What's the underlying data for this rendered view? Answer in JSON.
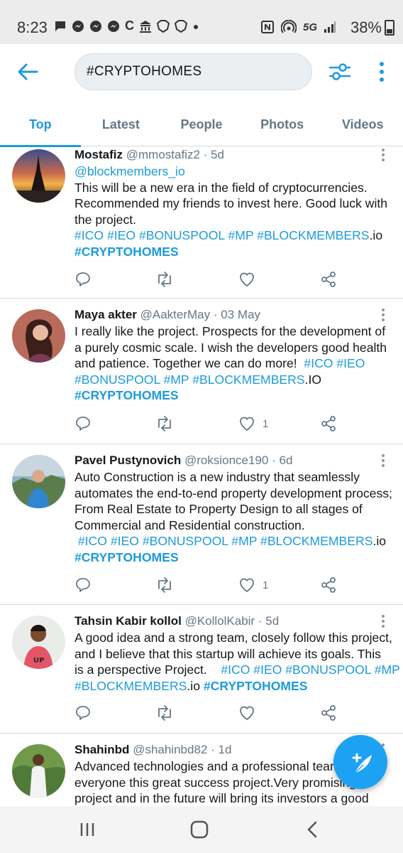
{
  "status_bar": {
    "time": "8:23",
    "network": "5G",
    "battery": "38%",
    "left_icons": [
      "chat-icon",
      "messenger-icon",
      "messenger-icon",
      "messenger-icon",
      "c-icon",
      "bank-icon",
      "brave-icon",
      "brave-icon",
      "dot-icon"
    ],
    "right_icons": [
      "nfc-icon",
      "hotspot-icon",
      "signal-icon",
      "battery-icon"
    ]
  },
  "search": {
    "query": "#CRYPTOHOMES"
  },
  "tabs": [
    {
      "label": "Top",
      "active": true
    },
    {
      "label": "Latest",
      "active": false
    },
    {
      "label": "People",
      "active": false
    },
    {
      "label": "Photos",
      "active": false
    },
    {
      "label": "Videos",
      "active": false
    }
  ],
  "colors": {
    "accent": "#1d9bd9",
    "fab": "#1da1f2",
    "secondary_text": "#657786"
  },
  "tweets": [
    {
      "name": "Mostafiz",
      "handle": "@mmostafiz2",
      "time": "5d",
      "lines": [
        [
          {
            "t": "@blockmembers_io",
            "s": "tag"
          }
        ],
        [
          {
            "t": "This will be a new era in the field of cryptocurrencies.",
            "s": ""
          }
        ],
        [
          {
            "t": "Recommended my friends to invest here. Good luck with",
            "s": ""
          }
        ],
        [
          {
            "t": "the project.",
            "s": ""
          }
        ],
        [
          {
            "t": "#ICO #IEO #BONUSPOOL #MP #BLOCKMEMBERS",
            "s": "tag"
          },
          {
            "t": ".io",
            "s": ""
          }
        ],
        [
          {
            "t": "#CRYPTOHOMES",
            "s": "tag-b"
          }
        ]
      ],
      "likes": ""
    },
    {
      "name": "Maya akter",
      "handle": "@AakterMay",
      "time": "03 May",
      "lines": [
        [
          {
            "t": "I really like the project. Prospects for the development of",
            "s": ""
          }
        ],
        [
          {
            "t": "a purely cosmic scale. I wish the developers good health",
            "s": ""
          }
        ],
        [
          {
            "t": "and patience. Together we can do more!  ",
            "s": ""
          },
          {
            "t": "#ICO #IEO",
            "s": "tag"
          }
        ],
        [
          {
            "t": "#BONUSPOOL #MP #BLOCKMEMBERS",
            "s": "tag"
          },
          {
            "t": ".IO",
            "s": ""
          }
        ],
        [
          {
            "t": "#CRYPTOHOMES",
            "s": "tag-b"
          }
        ]
      ],
      "likes": "1"
    },
    {
      "name": "Pavel Pustynovich",
      "handle": "@roksionce190",
      "time": "6d",
      "lines": [
        [
          {
            "t": "Auto Construction is a new industry that seamlessly",
            "s": ""
          }
        ],
        [
          {
            "t": "automates the end-to-end property development process;",
            "s": ""
          }
        ],
        [
          {
            "t": "From Real Estate to Property Design to all stages of",
            "s": ""
          }
        ],
        [
          {
            "t": "Commercial and Residential construction.",
            "s": ""
          }
        ],
        [
          {
            "t": " #ICO #IEO #BONUSPOOL #MP #BLOCKMEMBERS",
            "s": "tag"
          },
          {
            "t": ".io",
            "s": ""
          }
        ],
        [
          {
            "t": "#CRYPTOHOMES",
            "s": "tag-b"
          }
        ]
      ],
      "likes": "1"
    },
    {
      "name": "Tahsin Kabir kollol",
      "handle": "@KollolKabir",
      "time": "5d",
      "lines": [
        [
          {
            "t": "A good idea and a strong team, closely follow this project,",
            "s": ""
          }
        ],
        [
          {
            "t": "and I believe that this startup will achieve its goals. This",
            "s": ""
          }
        ],
        [
          {
            "t": "is a perspective Project.    ",
            "s": ""
          },
          {
            "t": "#ICO #IEO #BONUSPOOL #MP",
            "s": "tag"
          }
        ],
        [
          {
            "t": "#BLOCKMEMBERS",
            "s": "tag"
          },
          {
            "t": ".io ",
            "s": ""
          },
          {
            "t": "#CRYPTOHOMES",
            "s": "tag-b"
          }
        ]
      ],
      "likes": ""
    },
    {
      "name": "Shahinbd",
      "handle": "@shahinbd82",
      "time": "1d",
      "lines": [
        [
          {
            "t": "Advanced technologies and a professional team",
            "s": ""
          }
        ],
        [
          {
            "t": "everyone this great success project.Very promising",
            "s": ""
          }
        ],
        [
          {
            "t": "project and in the future will bring its investors a good",
            "s": ""
          }
        ]
      ],
      "likes": ""
    }
  ]
}
